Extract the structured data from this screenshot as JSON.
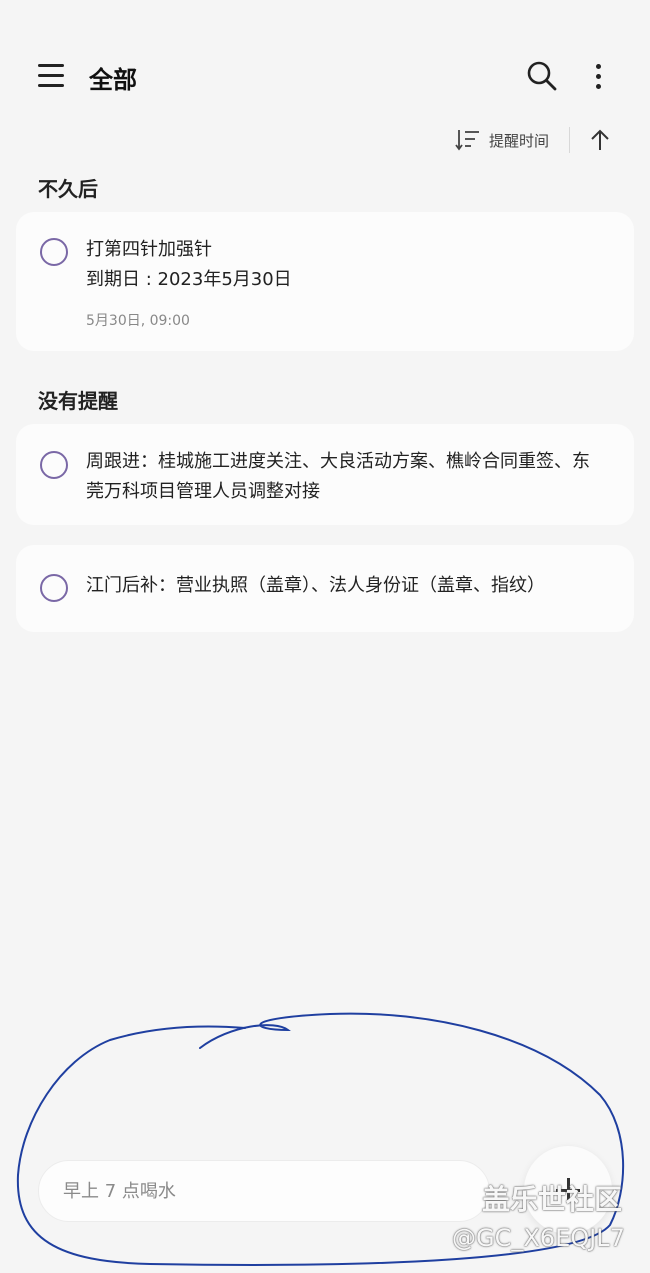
{
  "header": {
    "title": "全部",
    "menu_icon": "hamburger-menu-icon",
    "search_icon": "search-icon",
    "more_icon": "more-vertical-icon"
  },
  "sort": {
    "label": "提醒时间",
    "icon": "sort-icon",
    "direction_icon": "arrow-up-icon"
  },
  "sections": [
    {
      "title": "不久后",
      "items": [
        {
          "title": "打第四针加强针",
          "due": "到期日 : 2023年5月30日",
          "reminder": "5月30日, 09:00"
        }
      ]
    },
    {
      "title": "没有提醒",
      "items": [
        {
          "title": "周跟进：桂城施工进度关注、大良活动方案、樵岭合同重签、东莞万科项目管理人员调整对接"
        },
        {
          "title": "江门后补：营业执照（盖章）、法人身份证（盖章、指纹）"
        }
      ]
    }
  ],
  "quick_add": {
    "placeholder": "早上 7 点喝水",
    "add_icon": "plus-icon"
  },
  "watermark": {
    "line1": "盖乐世社区",
    "line2": "@GC_X6EQJL7"
  },
  "colors": {
    "background": "#f5f5f5",
    "card": "#fcfcfc",
    "checkbox_ring": "#7a68a6",
    "scribble": "#1f3fa0"
  }
}
